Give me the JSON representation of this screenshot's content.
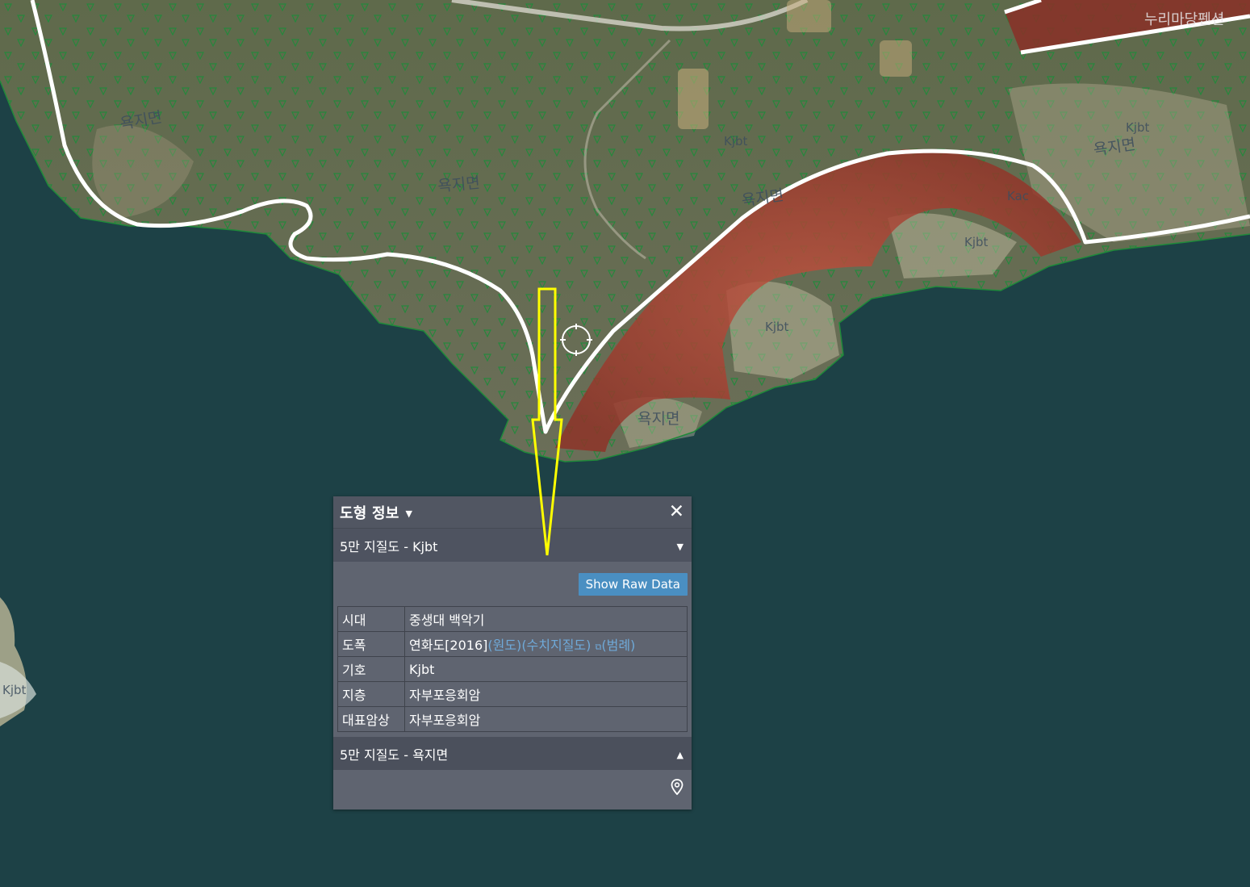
{
  "map": {
    "labels": {
      "top_right_text": "누리마당펜션",
      "region_1": "욕지면",
      "region_2": "욕지면",
      "region_3": "욕지면",
      "region_4": "욕지면",
      "region_5": "욕지면",
      "kjbt_1": "Kjbt",
      "kjbt_2": "Kjbt",
      "kjbt_3": "Kjbt",
      "kjbt_4": "Kjbt",
      "kjbt_5": "Kjbt",
      "kac": "Kac"
    },
    "colors": {
      "sea": "#1d4146",
      "land": "#5c6549",
      "overlay_red": "#a1382d",
      "boundary": "#ffffff",
      "marker_arrow": "#ffff00",
      "triangle_symbol": "#1f8a3a"
    }
  },
  "popup": {
    "title": "도형 정보",
    "close_symbol": "✕",
    "feature_1_label": "5만 지질도 - Kjbt",
    "raw_button": "Show Raw Data",
    "attributes": [
      {
        "key": "시대",
        "value": "중생대 백악기"
      },
      {
        "key": "도폭",
        "value": "연화도[2016]"
      },
      {
        "key": "기호",
        "value": "Kjbt"
      },
      {
        "key": "지층",
        "value": "자부포응회암"
      },
      {
        "key": "대표암상",
        "value": "자부포응회암"
      }
    ],
    "links": {
      "original": "(원도)",
      "digital": "(수치지질도)",
      "legend": "(범례)"
    },
    "feature_2_label": "5만 지질도 - 욕지면"
  }
}
